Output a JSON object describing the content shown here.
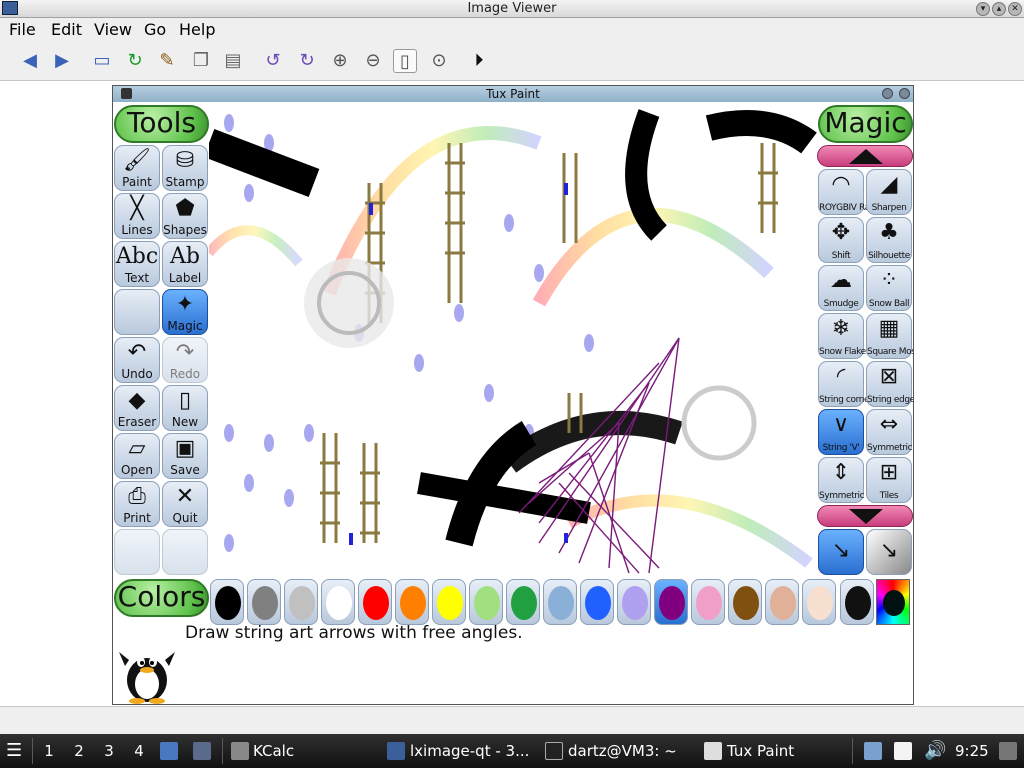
{
  "window": {
    "title": "Image Viewer",
    "menus": [
      "File",
      "Edit",
      "View",
      "Go",
      "Help"
    ]
  },
  "toolbar_icons": [
    "back-icon",
    "forward-icon",
    "open-icon",
    "reload-icon",
    "edit-icon",
    "copy-icon",
    "paste-icon",
    "rotate-ccw-icon",
    "rotate-cw-icon",
    "zoom-in-icon",
    "zoom-out-icon",
    "fit-icon",
    "original-size-icon",
    "slideshow-icon"
  ],
  "tuxpaint": {
    "title": "Tux Paint",
    "tools_header": "Tools",
    "magic_header": "Magic",
    "colors_header": "Colors",
    "hint": "Draw string art arrows with free angles.",
    "tools": [
      {
        "label": "Paint",
        "icon": "brush-icon"
      },
      {
        "label": "Stamp",
        "icon": "stamp-icon"
      },
      {
        "label": "Lines",
        "icon": "lines-icon"
      },
      {
        "label": "Shapes",
        "icon": "pentagon-icon"
      },
      {
        "label": "Text",
        "icon": "text-icon"
      },
      {
        "label": "Label",
        "icon": "label-icon"
      },
      {
        "label": "",
        "icon": "blank-icon"
      },
      {
        "label": "Magic",
        "icon": "magic-wand-icon"
      },
      {
        "label": "Undo",
        "icon": "undo-icon"
      },
      {
        "label": "Redo",
        "icon": "redo-icon"
      },
      {
        "label": "Eraser",
        "icon": "eraser-icon"
      },
      {
        "label": "New",
        "icon": "new-icon"
      },
      {
        "label": "Open",
        "icon": "open-icon"
      },
      {
        "label": "Save",
        "icon": "save-icon"
      },
      {
        "label": "Print",
        "icon": "printer-icon"
      },
      {
        "label": "Quit",
        "icon": "quit-icon"
      }
    ],
    "magic_tools": [
      {
        "label": "ROYGBIV Rainbow",
        "icon": "rainbow-icon"
      },
      {
        "label": "Sharpen",
        "icon": "sharpen-icon"
      },
      {
        "label": "Shift",
        "icon": "shift-icon"
      },
      {
        "label": "Silhouette",
        "icon": "tree-icon"
      },
      {
        "label": "Smudge",
        "icon": "smudge-icon"
      },
      {
        "label": "Snow Ball",
        "icon": "snowball-icon"
      },
      {
        "label": "Snow Flake",
        "icon": "snowflake-icon"
      },
      {
        "label": "Square Mosaic",
        "icon": "mosaic-icon"
      },
      {
        "label": "String corner",
        "icon": "string-corner-icon"
      },
      {
        "label": "String edges",
        "icon": "string-edges-icon"
      },
      {
        "label": "String 'V'",
        "icon": "string-v-icon"
      },
      {
        "label": "Symmetric Left/Right",
        "icon": "symmetric-lr-icon"
      },
      {
        "label": "Symmetric Up/Down",
        "icon": "fish-icon"
      },
      {
        "label": "Tiles",
        "icon": "tiles-icon"
      }
    ],
    "colors": [
      "#000000",
      "#808080",
      "#c0c0c0",
      "#ffffff",
      "#ff0000",
      "#ff8000",
      "#ffff00",
      "#a0e080",
      "#20a040",
      "#8ab0d8",
      "#2060ff",
      "#b0a0f0",
      "#800080",
      "#f0a0c8",
      "#805010",
      "#e0b098",
      "#f8e0d0"
    ]
  },
  "taskbar": {
    "desktops": [
      "1",
      "2",
      "3",
      "4"
    ],
    "tasks": [
      "KCalc",
      "lximage-qt - 3...",
      "dartz@VM3: ~",
      "Tux Paint"
    ],
    "clock": "9:25"
  }
}
